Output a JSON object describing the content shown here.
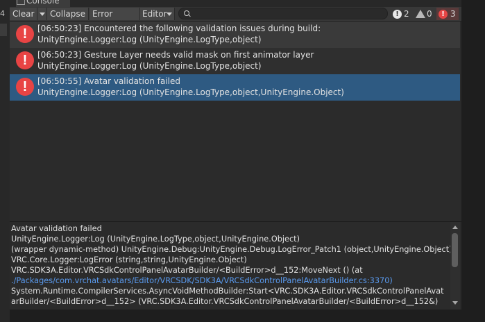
{
  "window": {
    "tab_label": "Console",
    "side_number": "4"
  },
  "toolbar": {
    "clear_label": "Clear",
    "collapse_label": "Collapse",
    "error_pause_label": "Error Pause",
    "editor_label": "Editor",
    "search_value": "",
    "info_count": "2",
    "warning_count": "0",
    "error_count": "3"
  },
  "log_entries": [
    {
      "line1": "[06:50:23] Encountered the following validation issues during build:",
      "line2": "UnityEngine.Logger:Log (UnityEngine.LogType,object)",
      "selected": false
    },
    {
      "line1": "[06:50:23] Gesture Layer needs valid mask on first animator layer",
      "line2": "UnityEngine.Logger:Log (UnityEngine.LogType,object)",
      "selected": false
    },
    {
      "line1": "[06:50:55] Avatar validation failed",
      "line2": "UnityEngine.Logger:Log (UnityEngine.LogType,object,UnityEngine.Object)",
      "selected": true
    }
  ],
  "detail": {
    "lines": [
      "Avatar validation failed",
      "UnityEngine.Logger:Log (UnityEngine.LogType,object,UnityEngine.Object)",
      "(wrapper dynamic-method) UnityEngine.Debug:UnityEngine.Debug.LogError_Patch1 (object,UnityEngine.Object)",
      "VRC.Core.Logger:LogError (string,string,UnityEngine.Object)",
      "VRC.SDK3A.Editor.VRCSdkControlPanelAvatarBuilder/<BuildError>d__152:MoveNext () (at",
      "./Packages/com.vrchat.avatars/Editor/VRCSDK/SDK3A/VRCSdkControlPanelAvatarBuilder.cs:3370)",
      "System.Runtime.CompilerServices.AsyncVoidMethodBuilder:Start<VRC.SDK3A.Editor.VRCSdkControlPanelAvat",
      "arBuilder/<BuildError>d__152> (VRC.SDK3A.Editor.VRCSdkControlPanelAvatarBuilder/<BuildError>d__152&)"
    ]
  },
  "colors": {
    "selected_row": "#2e5a82",
    "error_icon": "#e84444",
    "link": "#5a9bf0"
  }
}
